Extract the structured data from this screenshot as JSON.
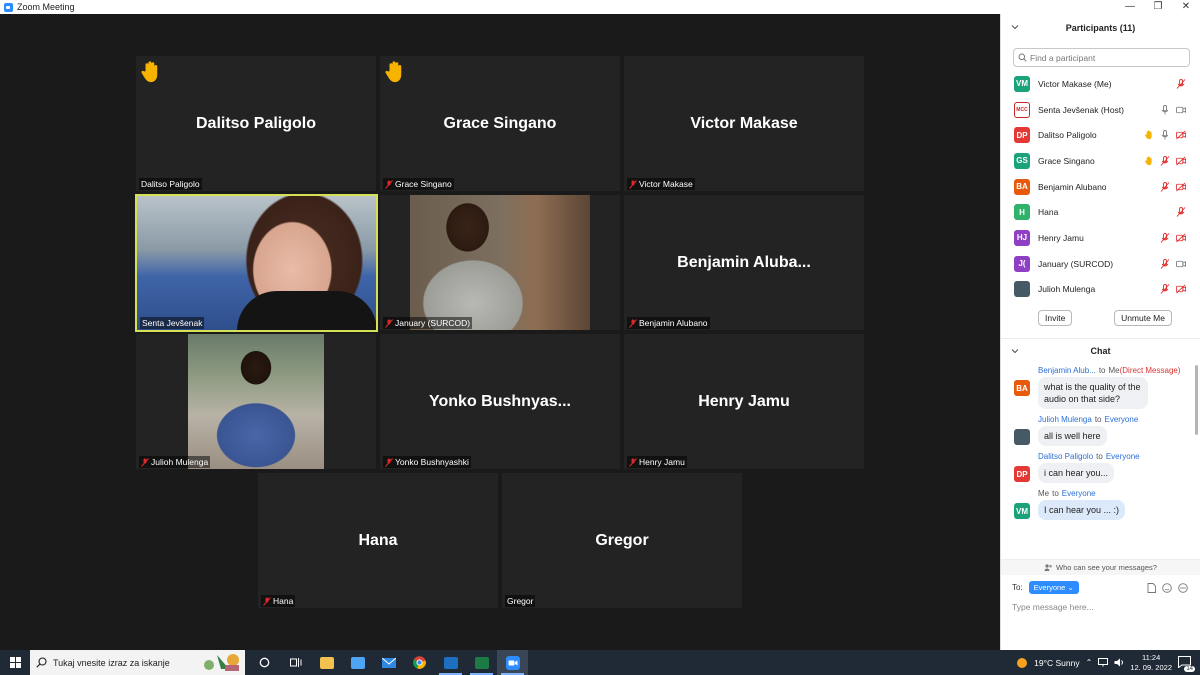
{
  "window": {
    "title": "Zoom Meeting",
    "controls": [
      "—",
      "❐",
      "✕"
    ]
  },
  "tiles": [
    {
      "big": "Dalitso Paligolo",
      "label": "Dalitso Paligolo",
      "hand": true,
      "muted": false
    },
    {
      "big": "Grace Singano",
      "label": "Grace Singano",
      "hand": true,
      "muted": true
    },
    {
      "big": "Victor Makase",
      "label": "Victor Makase",
      "hand": false,
      "muted": true
    },
    {
      "big": "",
      "label": "Senta Jevšenak",
      "video": "senta",
      "muted": false,
      "active": true
    },
    {
      "big": "",
      "label": "January (SURCOD)",
      "video": "jan",
      "muted": true
    },
    {
      "big": "Benjamin  Aluba...",
      "label": "Benjamin Alubano",
      "muted": true
    },
    {
      "big": "",
      "label": "Julioh Mulenga",
      "video": "jul",
      "muted": true
    },
    {
      "big": "Yonko  Bushnyas...",
      "label": "Yonko Bushnyashki",
      "muted": true
    },
    {
      "big": "Henry Jamu",
      "label": "Henry Jamu",
      "muted": true
    },
    {
      "big": "Hana",
      "label": "Hana",
      "muted": true
    },
    {
      "big": "Gregor",
      "label": "Gregor",
      "muted": false
    }
  ],
  "participants": {
    "title": "Participants (11)",
    "search_placeholder": "Find a participant",
    "list": [
      {
        "initials": "VM",
        "color": "#1aa37a",
        "name": "Victor Makase (Me)",
        "hand": false,
        "mic": "muted",
        "cam": "none"
      },
      {
        "initials": "MCC",
        "color": "#c62828",
        "name": "Senta Jevšenak (Host)",
        "hand": false,
        "mic": "on",
        "cam": "on"
      },
      {
        "initials": "DP",
        "color": "#e53935",
        "name": "Dalitso Paligolo",
        "hand": true,
        "mic": "on",
        "cam": "off"
      },
      {
        "initials": "GS",
        "color": "#1aa37a",
        "name": "Grace Singano",
        "hand": true,
        "mic": "muted",
        "cam": "off"
      },
      {
        "initials": "BA",
        "color": "#e8590c",
        "name": "Benjamin Alubano",
        "hand": false,
        "mic": "muted",
        "cam": "off"
      },
      {
        "initials": "H",
        "color": "#2fb36a",
        "name": "Hana",
        "hand": false,
        "mic": "muted",
        "cam": "none"
      },
      {
        "initials": "HJ",
        "color": "#8e3fc4",
        "name": "Henry Jamu",
        "hand": false,
        "mic": "muted",
        "cam": "off"
      },
      {
        "initials": "J(",
        "color": "#8e3fc4",
        "name": "January (SURCOD)",
        "hand": false,
        "mic": "muted",
        "cam": "on"
      },
      {
        "initials": "",
        "color": "#455a64",
        "name": "Julioh Mulenga",
        "hand": false,
        "mic": "muted",
        "cam": "off"
      }
    ],
    "invite_label": "Invite",
    "unmute_label": "Unmute Me"
  },
  "chat": {
    "title": "Chat",
    "messages": [
      {
        "from": "Benjamin Alub...",
        "to_prefix": "to",
        "to": "Me",
        "dm": "(Direct Message)",
        "initials": "BA",
        "color": "#e8590c",
        "text": "what is the quality of the audio on that side?",
        "me": false
      },
      {
        "from": "Julioh Mulenga",
        "to_prefix": "to",
        "to": "Everyone",
        "initials": "",
        "color": "#455a64",
        "text": "all is well here",
        "me": false
      },
      {
        "from": "Dalitso Paligolo",
        "to_prefix": "to",
        "to": "Everyone",
        "initials": "DP",
        "color": "#e53935",
        "text": "i can hear you...",
        "me": false
      },
      {
        "from": "Me",
        "to_prefix": "to",
        "to": "Everyone",
        "initials": "VM",
        "color": "#1aa37a",
        "text": "I can hear you ... :)",
        "me": true
      }
    ],
    "who_can_see": "Who can see your messages?",
    "to_label": "To:",
    "to_value": "Everyone ⌄",
    "placeholder": "Type message here..."
  },
  "taskbar": {
    "search_placeholder": "Tukaj vnesite izraz za iskanje",
    "weather": "19°C  Sunny",
    "time": "11:24",
    "date": "12. 09. 2022",
    "notif_count": "14"
  }
}
